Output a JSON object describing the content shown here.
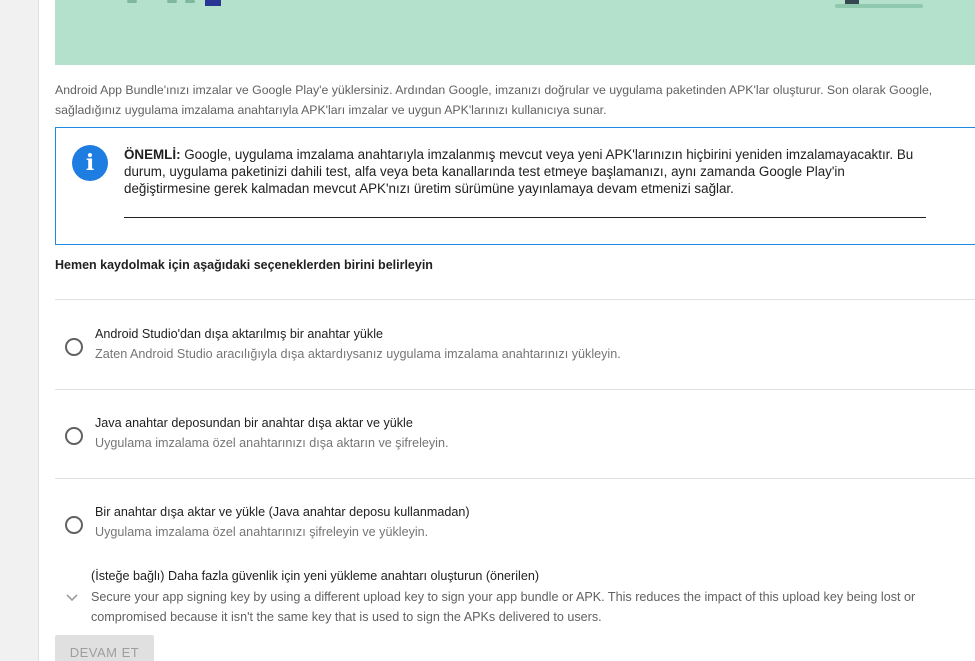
{
  "intro": {
    "line1": "Android App Bundle'ınızı imzalar ve Google Play'e yüklersiniz. Ardından Google, imzanızı doğrular ve uygulama paketinden APK'lar oluşturur. Son olarak Google,",
    "line2": "sağladığınız uygulama imzalama anahtarıyla APK'ları imzalar ve uygun APK'larınızı kullanıcıya sunar."
  },
  "notice": {
    "icon": "info-icon",
    "label": "ÖNEMLİ:",
    "text": " Google, uygulama imzalama anahtarıyla imzalanmış mevcut veya yeni APK'larınızın hiçbirini yeniden imzalamayacaktır. Bu durum, uygulama paketinizi dahili test, alfa veya beta kanallarında test etmeye başlamanızı, aynı zamanda Google Play'in değiştirmesine gerek kalmadan mevcut APK'nızı üretim sürümüne yayınlamaya devam etmenizi sağlar."
  },
  "section_title": "Hemen kaydolmak için aşağıdaki seçeneklerden birini belirleyin",
  "options": [
    {
      "title": "Android Studio'dan dışa aktarılmış bir anahtar yükle",
      "subtitle": "Zaten Android Studio aracılığıyla dışa aktardıysanız uygulama imzalama anahtarınızı yükleyin."
    },
    {
      "title": "Java anahtar deposundan bir anahtar dışa aktar ve yükle",
      "subtitle": "Uygulama imzalama özel anahtarınızı dışa aktarın ve şifreleyin."
    },
    {
      "title": "Bir anahtar dışa aktar ve yükle (Java anahtar deposu kullanmadan)",
      "subtitle": "Uygulama imzalama özel anahtarınızı şifreleyin ve yükleyin."
    }
  ],
  "optional": {
    "title": "(İsteğe bağlı) Daha fazla güvenlik için yeni yükleme anahtarı oluşturun (önerilen)",
    "description": "Secure your app signing key by using a different upload key to sign your app bundle or APK. This reduces the impact of this upload key being lost or compromised because it isn't the same key that is used to sign the APKs delivered to users.",
    "icon": "chevron-down-icon"
  },
  "continue_label": "DEVAM ET",
  "colors": {
    "banner": "#b3e1cc",
    "accent": "#1e7de0",
    "notice_border": "#1e88e5"
  }
}
